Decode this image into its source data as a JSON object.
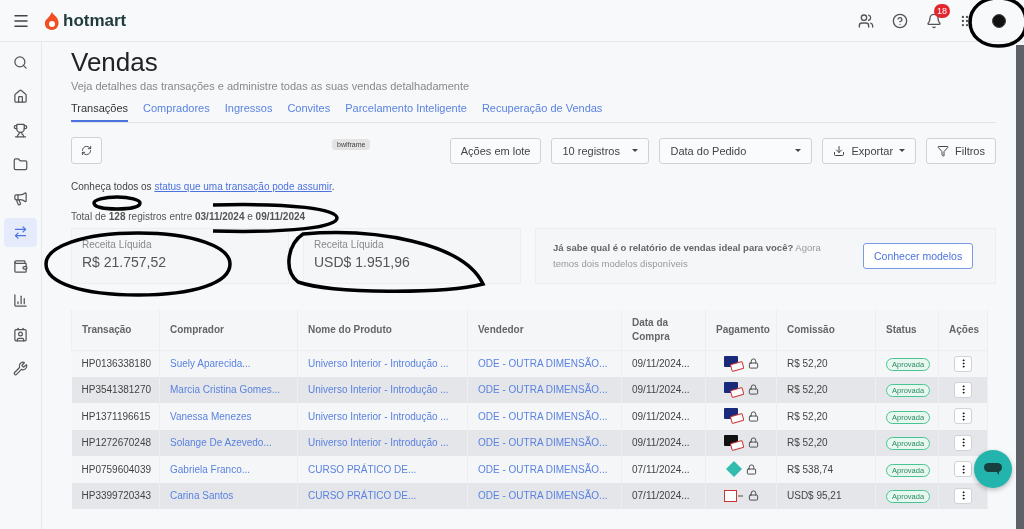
{
  "topbar": {
    "logo": "hotmart",
    "notifications": "18"
  },
  "sidebar": {
    "items": [
      {
        "kind": "search",
        "selected": false
      },
      {
        "kind": "home",
        "selected": false
      },
      {
        "kind": "trophy",
        "selected": false
      },
      {
        "kind": "folder",
        "selected": false
      },
      {
        "kind": "megaphone",
        "selected": false
      },
      {
        "kind": "exchange",
        "selected": true
      },
      {
        "kind": "wallet",
        "selected": false
      },
      {
        "kind": "chart",
        "selected": false
      },
      {
        "kind": "badge",
        "selected": false
      },
      {
        "kind": "tools",
        "selected": false
      }
    ]
  },
  "page": {
    "title": "Vendas",
    "subtitle": "Veja detalhes das transações e administre todas as suas vendas detalhadamente"
  },
  "tabs": [
    {
      "label": "Transações",
      "selected": true
    },
    {
      "label": "Compradores",
      "selected": false
    },
    {
      "label": "Ingressos",
      "selected": false
    },
    {
      "label": "Convites",
      "selected": false
    },
    {
      "label": "Parcelamento Inteligente",
      "selected": false
    },
    {
      "label": "Recuperação de Vendas",
      "selected": false
    }
  ],
  "toolbar": {
    "tag": "bwlframe",
    "batch": "Ações em lote",
    "page_size": "10 registros",
    "date_field": "Data do Pedido",
    "export": "Exportar",
    "filters": "Filtros"
  },
  "status_note": {
    "text": "Conheça todos os ",
    "link": "status que uma transação pode assumir",
    "end": "."
  },
  "summary": "Total de **128** registros entre **03/11/2024** e **09/11/2024**",
  "revenue": [
    {
      "label": "Receita Líquida",
      "value": "R$ 21.757,52"
    },
    {
      "label": "Receita Líquida",
      "value": "USD$ 1.951,96"
    }
  ],
  "promo": {
    "text": "**Já sabe qual é o relatório de vendas ideal para você?** Agora temos dois modelos disponíveis",
    "button": "Conhecer modelos"
  },
  "table": {
    "columns": [
      "Transação",
      "Comprador",
      "Nome do Produto",
      "Vendedor",
      "Data da Compra",
      "Pagamento",
      "Comissão",
      "Status",
      "Ações"
    ],
    "rows": [
      {
        "id": "HP0136338180",
        "buyer": "Suely Aparecida...",
        "product": "Universo Interior - Introdução ...",
        "seller": "ODE - OUTRA DIMENSÃO...",
        "date": "09/11/2024...",
        "payment": {
          "kind": "visa"
        },
        "commission": "R$ 52,20",
        "status": "Aprovada"
      },
      {
        "id": "HP3541381270",
        "buyer": "Marcia Cristina Gomes...",
        "product": "Universo Interior - Introdução ...",
        "seller": "ODE - OUTRA DIMENSÃO...",
        "date": "09/11/2024...",
        "payment": {
          "kind": "visa"
        },
        "commission": "R$ 52,20",
        "status": "Aprovada"
      },
      {
        "id": "HP1371196615",
        "buyer": "Vanessa Menezes",
        "product": "Universo Interior - Introdução ...",
        "seller": "ODE - OUTRA DIMENSÃO...",
        "date": "09/11/2024...",
        "payment": {
          "kind": "visa"
        },
        "commission": "R$ 52,20",
        "status": "Aprovada"
      },
      {
        "id": "HP1272670248",
        "buyer": "Solange De Azevedo...",
        "product": "Universo Interior - Introdução ...",
        "seller": "ODE - OUTRA DIMENSÃO...",
        "date": "09/11/2024...",
        "payment": {
          "kind": "dark-card"
        },
        "commission": "R$ 52,20",
        "status": "Aprovada"
      },
      {
        "id": "HP0759604039",
        "buyer": "Gabriela Franco...",
        "product": "CURSO PRÁTICO DE...",
        "seller": "ODE - OUTRA DIMENSÃO...",
        "date": "07/11/2024...",
        "payment": {
          "kind": "pix"
        },
        "commission": "R$ 538,74",
        "status": "Aprovada"
      },
      {
        "id": "HP3399720343",
        "buyer": "Carina Santos",
        "product": "CURSO PRÁTICO DE...",
        "seller": "ODE - OUTRA DIMENSÃO...",
        "date": "07/11/2024...",
        "payment": {
          "kind": "multibanco"
        },
        "commission": "USD$ 95,21",
        "status": "Aprovada"
      }
    ]
  }
}
